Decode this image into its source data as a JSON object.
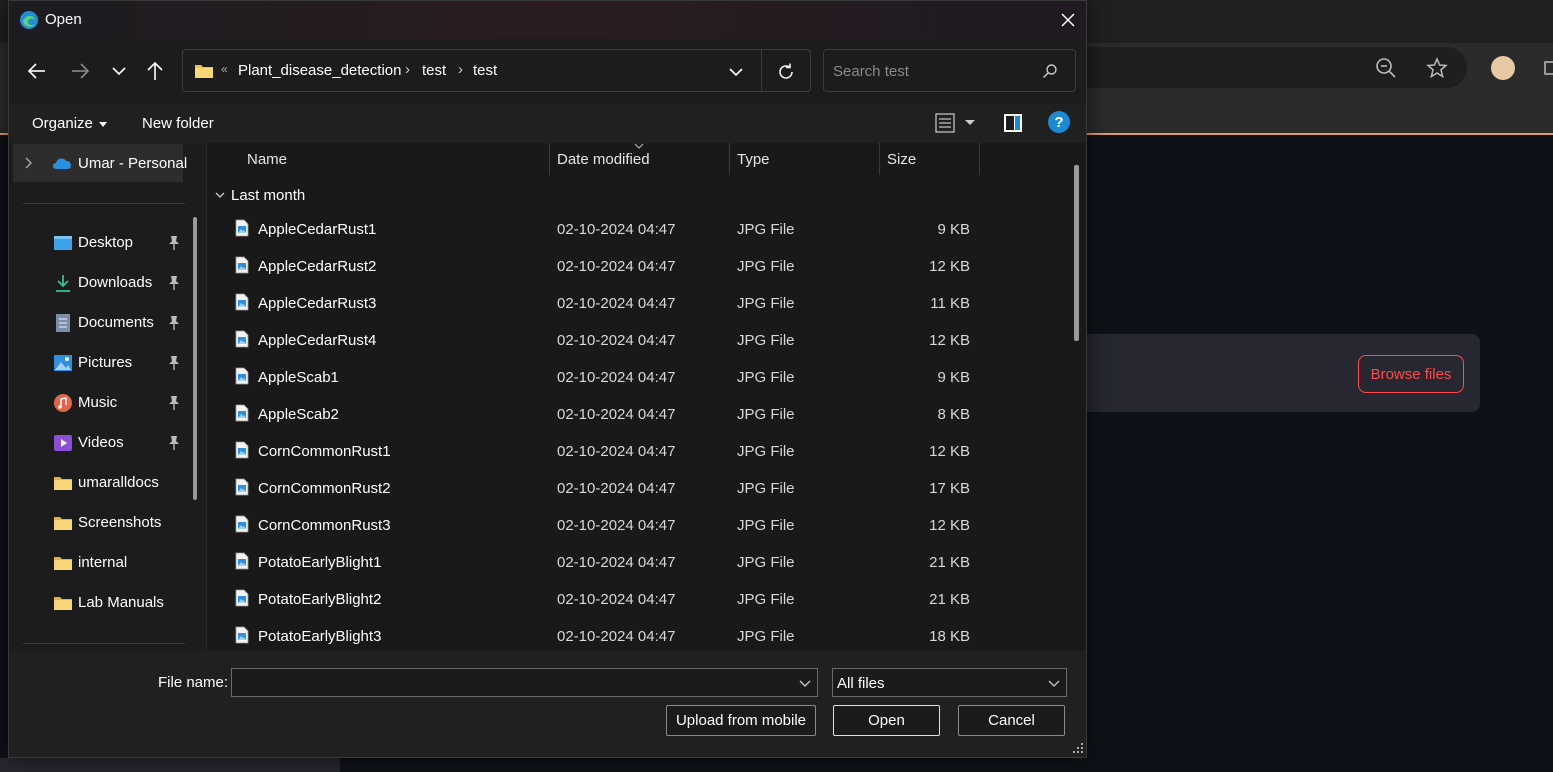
{
  "background": {
    "browse_button": "Browse files",
    "accent_color": "#ff4b4b"
  },
  "dialog": {
    "title": "Open",
    "breadcrumb": [
      "Plant_disease_detection",
      "test",
      "test"
    ],
    "search_placeholder": "Search test",
    "organize_label": "Organize",
    "new_folder_label": "New folder",
    "help_label": "?"
  },
  "sidebar": {
    "onedrive": "Umar - Personal",
    "items": [
      {
        "label": "Desktop",
        "icon": "desktop-icon",
        "pinned": true
      },
      {
        "label": "Downloads",
        "icon": "downloads-icon",
        "pinned": true
      },
      {
        "label": "Documents",
        "icon": "documents-icon",
        "pinned": true
      },
      {
        "label": "Pictures",
        "icon": "pictures-icon",
        "pinned": true
      },
      {
        "label": "Music",
        "icon": "music-icon",
        "pinned": true
      },
      {
        "label": "Videos",
        "icon": "videos-icon",
        "pinned": true
      },
      {
        "label": "umaralldocs",
        "icon": "folder-icon",
        "pinned": false
      },
      {
        "label": "Screenshots",
        "icon": "folder-icon",
        "pinned": false
      },
      {
        "label": "internal",
        "icon": "folder-icon",
        "pinned": false
      },
      {
        "label": "Lab Manuals",
        "icon": "folder-icon",
        "pinned": false
      }
    ]
  },
  "filelist": {
    "columns": {
      "name": "Name",
      "date": "Date modified",
      "type": "Type",
      "size": "Size"
    },
    "group": "Last month",
    "rows": [
      {
        "name": "AppleCedarRust1",
        "date": "02-10-2024 04:47",
        "type": "JPG File",
        "size": "9 KB"
      },
      {
        "name": "AppleCedarRust2",
        "date": "02-10-2024 04:47",
        "type": "JPG File",
        "size": "12 KB"
      },
      {
        "name": "AppleCedarRust3",
        "date": "02-10-2024 04:47",
        "type": "JPG File",
        "size": "11 KB"
      },
      {
        "name": "AppleCedarRust4",
        "date": "02-10-2024 04:47",
        "type": "JPG File",
        "size": "12 KB"
      },
      {
        "name": "AppleScab1",
        "date": "02-10-2024 04:47",
        "type": "JPG File",
        "size": "9 KB"
      },
      {
        "name": "AppleScab2",
        "date": "02-10-2024 04:47",
        "type": "JPG File",
        "size": "8 KB"
      },
      {
        "name": "CornCommonRust1",
        "date": "02-10-2024 04:47",
        "type": "JPG File",
        "size": "12 KB"
      },
      {
        "name": "CornCommonRust2",
        "date": "02-10-2024 04:47",
        "type": "JPG File",
        "size": "17 KB"
      },
      {
        "name": "CornCommonRust3",
        "date": "02-10-2024 04:47",
        "type": "JPG File",
        "size": "12 KB"
      },
      {
        "name": "PotatoEarlyBlight1",
        "date": "02-10-2024 04:47",
        "type": "JPG File",
        "size": "21 KB"
      },
      {
        "name": "PotatoEarlyBlight2",
        "date": "02-10-2024 04:47",
        "type": "JPG File",
        "size": "21 KB"
      },
      {
        "name": "PotatoEarlyBlight3",
        "date": "02-10-2024 04:47",
        "type": "JPG File",
        "size": "18 KB"
      }
    ]
  },
  "footer": {
    "filename_label": "File name:",
    "filename_value": "",
    "filter_value": "All files",
    "upload_label": "Upload from mobile",
    "open_label": "Open",
    "cancel_label": "Cancel"
  }
}
